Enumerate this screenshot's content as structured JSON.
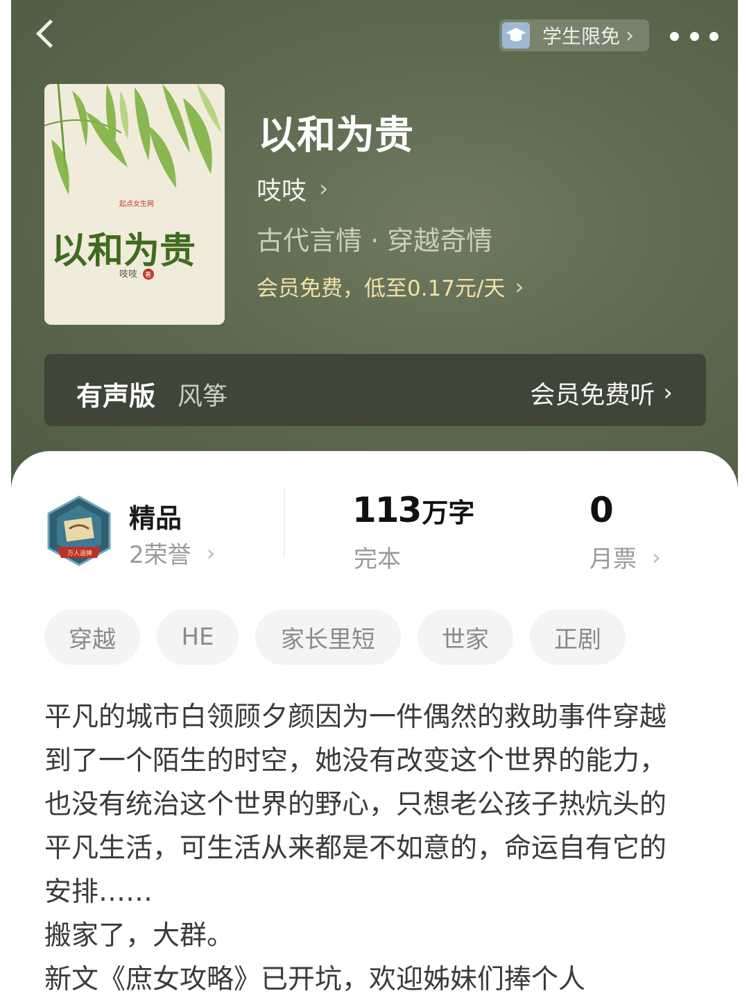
{
  "topbar": {
    "back_icon": "chevron-left-icon",
    "student_badge": {
      "icon": "graduation-cap-icon",
      "label": "学生限免",
      "chevron": "›"
    },
    "more_icon": "more-dots-icon"
  },
  "book": {
    "title": "以和为贵",
    "author": "吱吱",
    "genres": "古代言情 · 穿越奇情",
    "vip_offer": "会员免费，低至0.17元/天",
    "cover": {
      "calligraphy": "以和为贵",
      "publisher": "起点女生网",
      "author": "吱吱",
      "author_suffix": "著"
    }
  },
  "audio": {
    "label": "有声版",
    "narrator": "风筝",
    "action": "会员免费听"
  },
  "stats": {
    "quality": {
      "label": "精品",
      "honors": "2荣誉",
      "badge_text": "万人追捧"
    },
    "words": {
      "number": "113",
      "unit": "万字",
      "status": "完本"
    },
    "tickets": {
      "number": "0",
      "label": "月票"
    }
  },
  "tags": [
    "穿越",
    "HE",
    "家长里短",
    "世家",
    "正剧"
  ],
  "description": [
    "平凡的城市白领顾夕颜因为一件偶然的救助事件穿越到了一个陌生的时空，她没有改变这个世界的能力，也没有统治这个世界的野心，只想老公孩子热炕头的平凡生活，可生活从来都是不如意的，命运自有它的安排……",
    "搬家了，大群。",
    "新文《庶女攻略》已开坑，欢迎姊妹们捧个人"
  ],
  "colors": {
    "hero_bg": "#5d6a50",
    "audio_bar": "#3f4637",
    "vip_gold": "#f4e1a6",
    "tag_bg": "#f4f4f4"
  }
}
